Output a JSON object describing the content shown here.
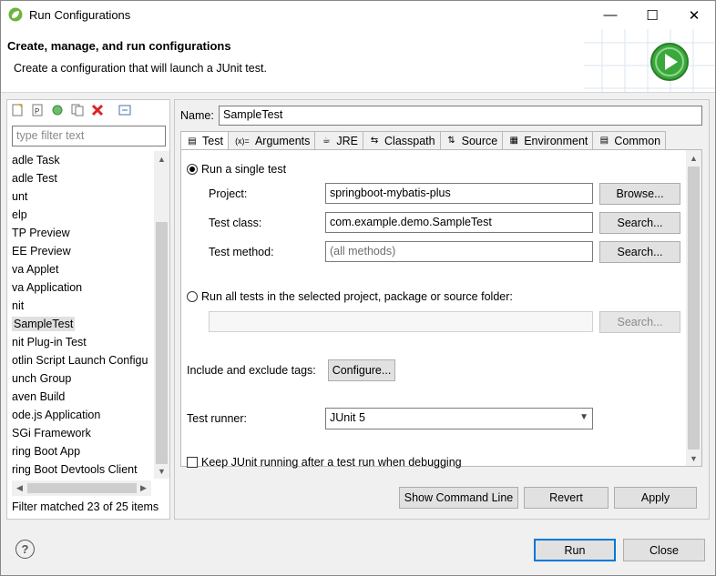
{
  "window": {
    "title": "Run Configurations",
    "minimize_glyph": "—",
    "maximize_glyph": "☐",
    "close_glyph": "✕"
  },
  "banner": {
    "title": "Create, manage, and run configurations",
    "message": "Create a configuration that will launch a JUnit test."
  },
  "left": {
    "filter_placeholder": "type filter text",
    "tree_items": [
      "adle Task",
      "adle Test",
      "unt",
      "elp",
      "TP Preview",
      "EE Preview",
      "va Applet",
      "va Application",
      "nit",
      "SampleTest",
      "nit Plug-in Test",
      "otlin Script Launch Configu",
      "unch Group",
      "aven Build",
      "ode.js Application",
      "SGi Framework",
      "ring Boot App",
      "ring Boot Devtools Client"
    ],
    "selected_index": 9,
    "filter_status": "Filter matched 23 of 25 items"
  },
  "right": {
    "name_label": "Name:",
    "name_value": "SampleTest",
    "tabs": [
      {
        "label": "Test",
        "icon": "test-tab-icon",
        "glyph": "▤"
      },
      {
        "label": "Arguments",
        "icon": "arguments-tab-icon",
        "glyph": "(x)="
      },
      {
        "label": "JRE",
        "icon": "jre-tab-icon",
        "glyph": "☕"
      },
      {
        "label": "Classpath",
        "icon": "classpath-tab-icon",
        "glyph": "⇆"
      },
      {
        "label": "Source",
        "icon": "source-tab-icon",
        "glyph": "⇅"
      },
      {
        "label": "Environment",
        "icon": "environment-tab-icon",
        "glyph": "▦"
      },
      {
        "label": "Common",
        "icon": "common-tab-icon",
        "glyph": "▤"
      }
    ],
    "single_test_label": "Run a single test",
    "project_label": "Project:",
    "project_value": "springboot-mybatis-plus",
    "browse_label": "Browse...",
    "test_class_label": "Test class:",
    "test_class_value": "com.example.demo.SampleTest",
    "search_label": "Search...",
    "test_method_label": "Test method:",
    "test_method_placeholder": "(all methods)",
    "run_all_label": "Run all tests in the selected project, package or source folder:",
    "tags_label": "Include and exclude tags:",
    "configure_label": "Configure...",
    "runner_label": "Test runner:",
    "runner_value": "JUnit 5",
    "keep_running_label": "Keep JUnit running after a test run when debugging",
    "show_cmd_label": "Show Command Line",
    "revert_label": "Revert",
    "apply_label": "Apply"
  },
  "footer": {
    "help_glyph": "?",
    "run_label": "Run",
    "close_label": "Close"
  },
  "colors": {
    "accent": "#0078d7",
    "run_badge": "#3aa83a"
  }
}
